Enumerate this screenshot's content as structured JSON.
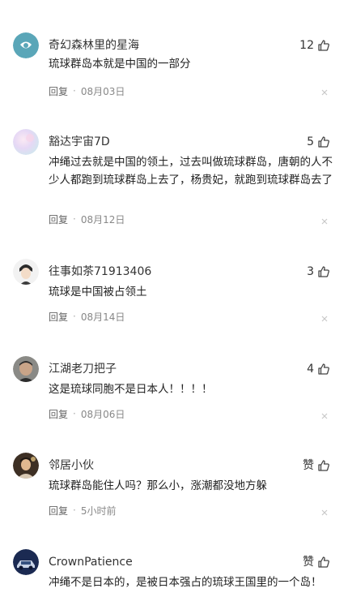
{
  "comments": [
    {
      "username": "奇幻森林里的星海",
      "likes": "12",
      "text": "琉球群岛本就是中国的一部分",
      "reply_label": "回复",
      "separator": "·",
      "date": "08月03日"
    },
    {
      "username": "豁达宇宙7D",
      "likes": "5",
      "text": "冲绳过去就是中国的领土，过去叫做琉球群岛，唐朝的人不少人都跑到琉球群岛上去了，杨贵妃，就跑到琉球群岛去了",
      "reply_label": "回复",
      "separator": "·",
      "date": "08月12日"
    },
    {
      "username": "往事如茶71913406",
      "likes": "3",
      "text": "琉球是中国被占领土",
      "reply_label": "回复",
      "separator": "·",
      "date": "08月14日"
    },
    {
      "username": "江湖老刀把子",
      "likes": "4",
      "text": "这是琉球同胞不是日本人！！！！",
      "reply_label": "回复",
      "separator": "·",
      "date": "08月06日"
    },
    {
      "username": "邻居小伙",
      "likes": "赞",
      "text": "琉球群岛能住人吗？那么小，涨潮都没地方躲",
      "reply_label": "回复",
      "separator": "·",
      "date": "5小时前"
    },
    {
      "username": "CrownPatience",
      "likes": "赞",
      "text": "冲绳不是日本的，是被日本强占的琉球王国里的一个岛！",
      "reply_label": "",
      "separator": "",
      "date": ""
    }
  ],
  "icons": {
    "like": "thumbs-up-icon",
    "dismiss": "close-icon"
  },
  "colors": {
    "text_primary": "#222222",
    "text_meta": "#888888",
    "icon": "#444444",
    "close": "#c8c8c8"
  }
}
